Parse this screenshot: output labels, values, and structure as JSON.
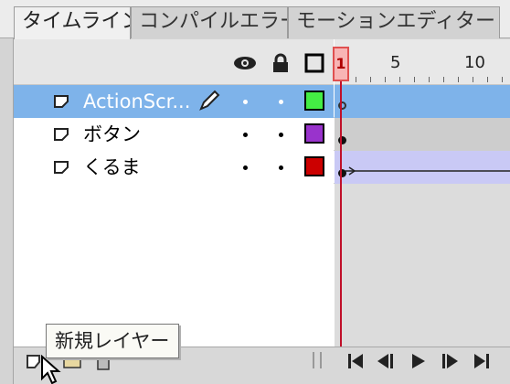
{
  "tabs": [
    {
      "label": "タイムライン",
      "active": true
    },
    {
      "label": "コンパイルエラー",
      "active": false
    },
    {
      "label": "モーションエディター",
      "active": false
    }
  ],
  "header": {
    "icons": [
      "eye-icon",
      "lock-icon",
      "outline-icon"
    ]
  },
  "ruler": {
    "current_frame": "1",
    "labels": [
      "5",
      "10"
    ]
  },
  "layers": [
    {
      "name": "ActionScr...",
      "color": "#44ee44",
      "selected": true,
      "editing": true
    },
    {
      "name": "ボタン",
      "color": "#9933cc",
      "selected": false,
      "editing": false
    },
    {
      "name": "くるま",
      "color": "#cc0000",
      "selected": false,
      "editing": false
    }
  ],
  "tooltip": {
    "text": "新規レイヤー"
  },
  "controls": [
    "go-to-first-frame",
    "step-back",
    "play",
    "step-forward",
    "go-to-last-frame"
  ]
}
